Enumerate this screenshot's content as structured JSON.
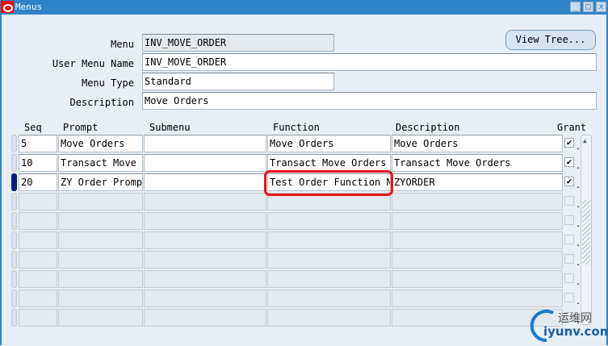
{
  "window": {
    "title": "Menus",
    "minimize": "_",
    "maximize": "□",
    "close": "x"
  },
  "header": {
    "menu_label": "Menu",
    "menu_value": "INV_MOVE_ORDER",
    "user_menu_name_label": "User Menu Name",
    "user_menu_name_value": "INV_MOVE_ORDER",
    "menu_type_label": "Menu Type",
    "menu_type_value": "Standard",
    "description_label": "Description",
    "description_value": "Move Orders",
    "view_tree_button": "View Tree..."
  },
  "table": {
    "columns": {
      "seq": "Seq",
      "prompt": "Prompt",
      "submenu": "Submenu",
      "function": "Function",
      "description": "Description",
      "grant": "Grant"
    },
    "rows": [
      {
        "seq": "5",
        "prompt": "Move Orders",
        "submenu": "",
        "function": "Move Orders",
        "description": "Move Orders",
        "grant": "✔"
      },
      {
        "seq": "10",
        "prompt": "Transact Move Orders",
        "submenu": "",
        "function": "Transact Move Orders",
        "description": "Transact Move Orders",
        "grant": "✔"
      },
      {
        "seq": "20",
        "prompt": "ZY Order Prompt",
        "submenu": "",
        "function": "Test Order Function Name",
        "description": "ZYORDER",
        "grant": "✔"
      }
    ]
  },
  "watermark": {
    "cn": "运维网",
    "en": "iyunv.com"
  }
}
